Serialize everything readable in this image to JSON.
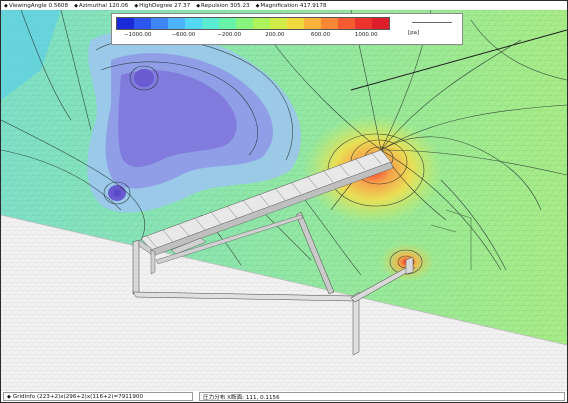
{
  "status": {
    "viewing_angle": "ViewingAngle  0.5608",
    "azimuthal": "Azimuthal 120.06",
    "high_degree": "HighDegree 27.37",
    "repulsion": "Repulsion 305.23",
    "magnification": "Magnification 417.9178",
    "bullet": "◆"
  },
  "legend": {
    "ticks": [
      "−1000.00",
      "−600.00",
      "−200.00",
      "200.00",
      "600.00",
      "1000.00"
    ],
    "unit": "[pa]",
    "colors": [
      "#1a2ad8",
      "#2c56ee",
      "#3f86f7",
      "#4db4fb",
      "#53d7f2",
      "#59ecd2",
      "#67f4a8",
      "#88f67c",
      "#acf35c",
      "#d1ec46",
      "#f0d83d",
      "#fbb238",
      "#fb8634",
      "#f65a31",
      "#ec342e",
      "#de1c2a"
    ]
  },
  "bottom": {
    "grid_info": "GridInfo  (223+2)x(296+2)x(116+2)=7911900",
    "pressure": "圧力分布 X断面: 111,  0.1156"
  }
}
